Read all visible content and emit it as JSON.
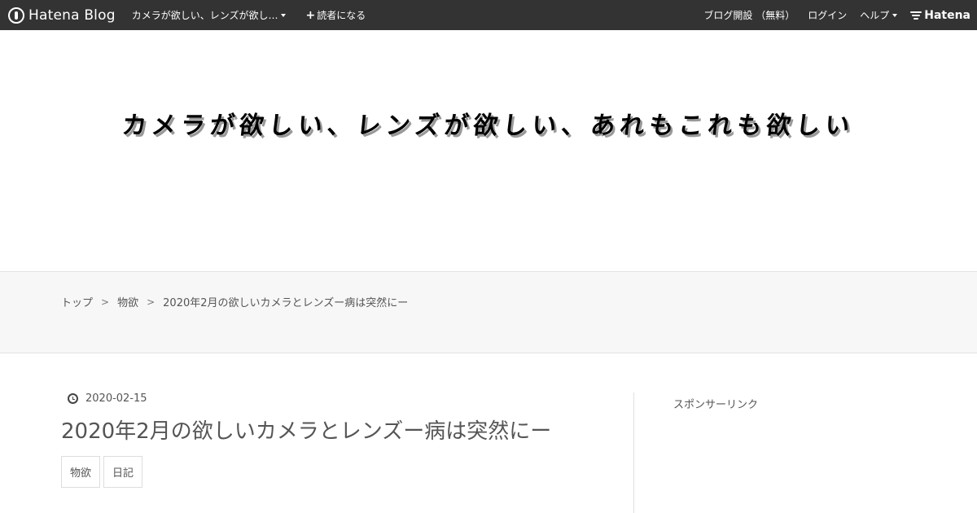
{
  "navbar": {
    "logo_text": "Hatena Blog",
    "blog_name": "カメラが欲しい、レンズが欲し…",
    "follow_label": "読者になる",
    "follow_icon": "+",
    "open_blog": "ブログ開設 （無料）",
    "login": "ログイン",
    "help": "ヘルプ",
    "brand": "Hatena",
    "colors": {
      "background": "#333333"
    }
  },
  "header": {
    "title": "カメラが欲しい、レンズが欲しい、あれもこれも欲しい"
  },
  "breadcrumb": {
    "items": [
      "トップ",
      "物欲",
      "2020年2月の欲しいカメラとレンズー病は突然にー"
    ],
    "separator": ">"
  },
  "entry": {
    "date": "2020-02-15",
    "title": "2020年2月の欲しいカメラとレンズー病は突然にー",
    "tags": [
      "物欲",
      "日記"
    ]
  },
  "sidebar": {
    "sponsor_label": "スポンサーリンク"
  }
}
